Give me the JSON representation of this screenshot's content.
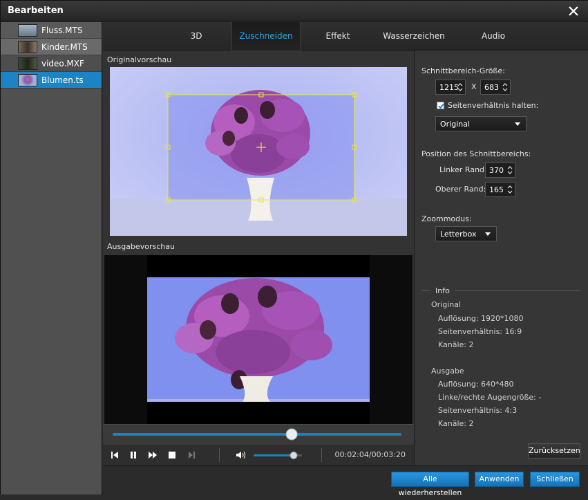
{
  "window": {
    "title": "Bearbeiten"
  },
  "files": [
    {
      "name": "Fluss.MTS",
      "thumb_color": "#7d8fa3"
    },
    {
      "name": "Kinder.MTS",
      "thumb_color": "#5b4a3a"
    },
    {
      "name": "video.MXF",
      "thumb_color": "#2e3a2c"
    },
    {
      "name": "Blumen.ts",
      "thumb_color": "#8fa7c3",
      "selected": true
    }
  ],
  "tabs": [
    "3D",
    "Zuschneiden",
    "Effekt",
    "Wasserzeichen",
    "Audio"
  ],
  "active_tab": "Zuschneiden",
  "preview": {
    "original_label": "Originalvorschau",
    "output_label": "Ausgabevorschau"
  },
  "player": {
    "time": "00:02:04/00:03:20",
    "progress": 0.62,
    "volume": 0.8
  },
  "crop": {
    "size_label": "Schnittbereich-Größe:",
    "width": "1215",
    "x_label": "X",
    "height": "683",
    "keep_ratio_label": "Seitenverhältnis halten:",
    "keep_ratio_checked": true,
    "ratio_value": "Original",
    "position_label": "Position des Schnittbereichs:",
    "left_label": "Linker Rand:",
    "left_value": "370",
    "top_label": "Oberer Rand:",
    "top_value": "165",
    "zoom_label": "Zoommodus:",
    "zoom_value": "Letterbox"
  },
  "info": {
    "header": "Info",
    "original_header": "Original",
    "original": [
      "Auflösung: 1920*1080",
      "Seitenverhältnis: 16:9",
      "Kanäle: 2"
    ],
    "output_header": "Ausgabe",
    "output": [
      "Auflösung: 640*480",
      "Linke/rechte Augengröße: -",
      "Seitenverhältnis: 4:3",
      "Kanäle: 2"
    ]
  },
  "buttons": {
    "reset": "Zurücksetzen",
    "restore_all": "Alle wiederherstellen",
    "apply": "Anwenden",
    "close": "Schließen"
  },
  "colors": {
    "accent": "#2fa4e7",
    "selected": "#1c84c4",
    "crop_frame": "#e8e83a"
  }
}
